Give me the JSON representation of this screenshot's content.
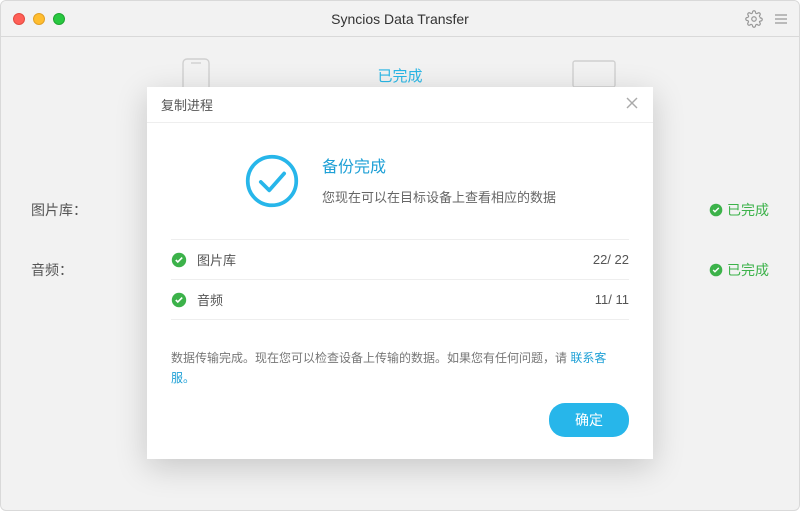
{
  "window": {
    "title": "Syncios Data Transfer"
  },
  "bg": {
    "status": "已完成",
    "rows": [
      {
        "label": "图片库：",
        "status": "已完成"
      },
      {
        "label": "音频：",
        "status": "已完成"
      }
    ]
  },
  "modal": {
    "title": "复制进程",
    "result_title": "备份完成",
    "result_sub": "您现在可以在目标设备上查看相应的数据",
    "items": [
      {
        "name": "图片库",
        "count": "22/ 22"
      },
      {
        "name": "音频",
        "count": "11/ 11"
      }
    ],
    "footer_text": "数据传输完成。现在您可以检查设备上传输的数据。如果您有任何问题，请 ",
    "footer_link": "联系客服。",
    "ok": "确定"
  },
  "colors": {
    "accent": "#27b6ea",
    "success": "#3cb24a"
  }
}
